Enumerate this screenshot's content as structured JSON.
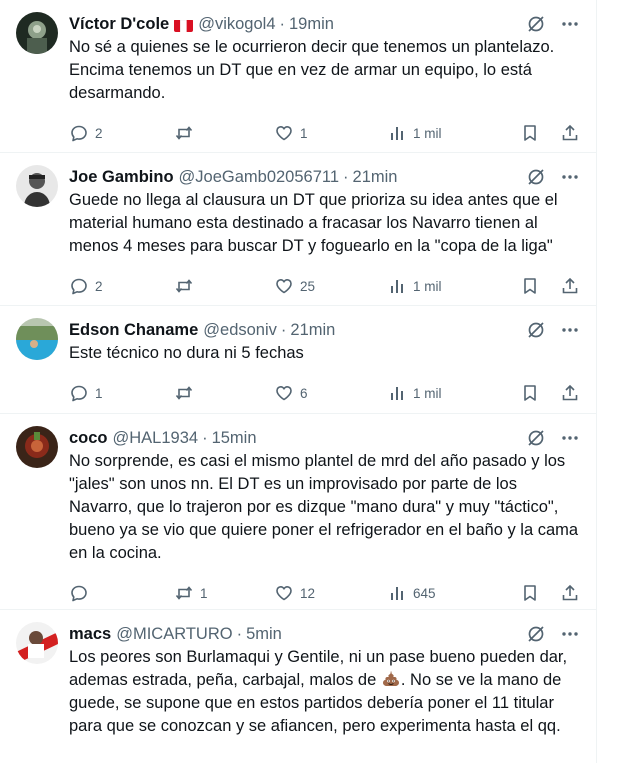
{
  "tweets": [
    {
      "name": "Víctor D'cole",
      "has_flag": true,
      "flag_colors": [
        "#d91023",
        "#ffffff",
        "#d91023"
      ],
      "handle": "@vikogol4",
      "time": "19min",
      "text": "No sé a quienes se le ocurrieron decir que tenemos un plantelazo. Encima tenemos un DT que en vez de armar un equipo, lo está desarmando.",
      "replies": "2",
      "retweets": "",
      "likes": "1",
      "views": "1 mil"
    },
    {
      "name": "Joe Gambino",
      "handle": "@JoeGamb02056711",
      "time": "21min",
      "text": "Guede no llega al clausura un DT que prioriza su idea antes que el material humano esta destinado a fracasar los Navarro tienen al menos 4 meses para buscar DT y foguearlo en la \"copa de la liga\"",
      "replies": "2",
      "retweets": "",
      "likes": "25",
      "views": "1 mil"
    },
    {
      "name": "Edson Chaname",
      "handle": "@edsoniv",
      "time": "21min",
      "text": "Este técnico no dura ni 5 fechas",
      "replies": "1",
      "retweets": "",
      "likes": "6",
      "views": "1 mil"
    },
    {
      "name": "coco",
      "handle": "@HAL1934",
      "time": "15min",
      "text": "No sorprende, es casi el mismo plantel de mrd del año pasado y los \"jales\" son unos nn. El DT es un improvisado por parte de los Navarro, que lo trajeron por es dizque \"mano dura\" y muy \"táctico\", bueno ya se vio que quiere poner el refrigerador en el baño y la cama en la cocina.",
      "replies": "",
      "retweets": "1",
      "likes": "12",
      "views": "645"
    },
    {
      "name": "macs",
      "handle": "@MICARTURO",
      "time": "5min",
      "text_before_emoji": "Los peores son Burlamaqui y Gentile, ni un pase bueno pueden dar, ademas estrada, peña, carbajal, malos de ",
      "emoji": "pile-of-poo-emoji",
      "text_after_emoji": ". No se ve la mano de guede, se supone que en estos partidos debería poner el 11 titular para que se conozcan y se afiancen, pero experimenta hasta el qq."
    }
  ],
  "icons": {
    "reply": "reply-icon",
    "retweet": "retweet-icon",
    "like": "heart-icon",
    "views": "views-icon",
    "bookmark": "bookmark-icon",
    "share": "share-icon",
    "grok": "grok-icon",
    "more": "more-icon"
  },
  "colors": {
    "text_primary": "#0f1419",
    "text_secondary": "#536471",
    "divider": "#eff3f4"
  }
}
